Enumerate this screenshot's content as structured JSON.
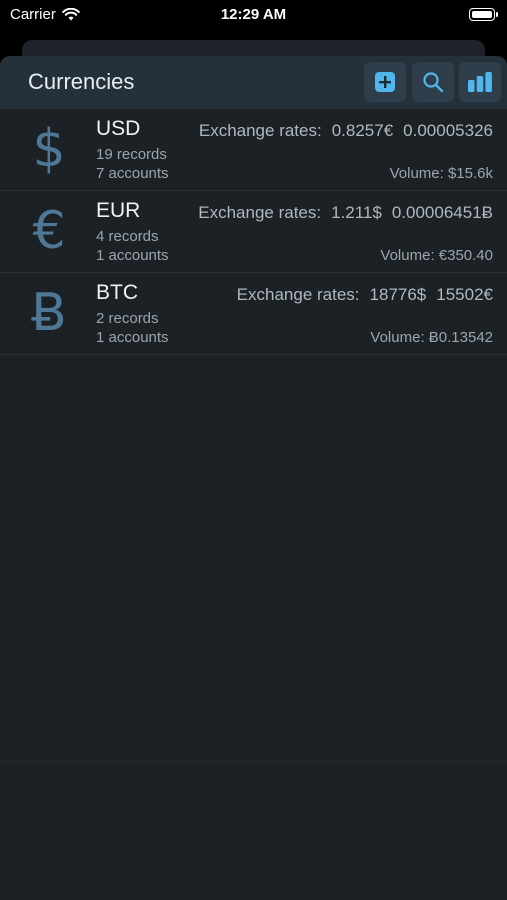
{
  "status_bar": {
    "carrier": "Carrier",
    "time": "12:29 AM"
  },
  "nav": {
    "title": "Currencies"
  },
  "currencies": [
    {
      "symbol": "$",
      "code": "USD",
      "rates_label": "Exchange rates:",
      "rate1": "0.8257€",
      "rate2": "0.00005326",
      "records": "19 records",
      "accounts": "7 accounts",
      "volume": "Volume: $15.6k"
    },
    {
      "symbol": "€",
      "code": "EUR",
      "rates_label": "Exchange rates:",
      "rate1": "1.211$",
      "rate2": "0.00006451Ƀ",
      "records": "4 records",
      "accounts": "1 accounts",
      "volume": "Volume: €350.40"
    },
    {
      "symbol": "Ƀ",
      "code": "BTC",
      "rates_label": "Exchange rates:",
      "rate1": "18776$",
      "rate2": "15502€",
      "records": "2 records",
      "accounts": "1 accounts",
      "volume": "Volume: Ƀ0.13542"
    }
  ],
  "colors": {
    "accent": "#4fb6ee",
    "background": "#1c2126",
    "nav_background": "#24303a",
    "symbol": "#4f7896"
  },
  "icons": [
    "wifi-icon",
    "battery-icon",
    "add-icon",
    "search-icon",
    "bar-chart-icon"
  ]
}
